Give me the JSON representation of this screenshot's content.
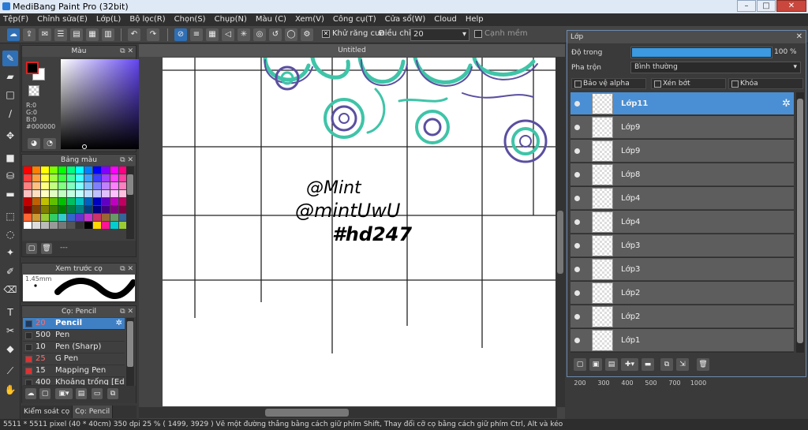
{
  "window": {
    "title": "MediBang Paint Pro (32bit)"
  },
  "menu": [
    "Tệp(F)",
    "Chỉnh sửa(E)",
    "Lớp(L)",
    "Bộ lọc(R)",
    "Chọn(S)",
    "Chụp(N)",
    "Màu (C)",
    "Xem(V)",
    "Công cụ(T)",
    "Cửa sổ(W)",
    "Cloud",
    "Help"
  ],
  "toolbar": {
    "antialias_label": "Khử răng cưa",
    "antialias_checked": "✕",
    "adjust_label": "Điều chỉnh",
    "adjust_value": "20",
    "smooth_label": "Cạnh mềm"
  },
  "color_panel": {
    "title": "Màu",
    "r": "R:0",
    "g": "G:0",
    "b": "B:0",
    "hex": "#000000",
    "fg_color": "#000000",
    "bg_color": "#ffffff"
  },
  "palette_panel": {
    "title": "Bảng màu",
    "name_placeholder": "---",
    "colors": [
      "#ff0000",
      "#ff8000",
      "#ffff00",
      "#80ff00",
      "#00ff00",
      "#00ff80",
      "#00ffff",
      "#0080ff",
      "#0000ff",
      "#8000ff",
      "#ff00ff",
      "#ff0080",
      "#ff4040",
      "#ffa040",
      "#ffff40",
      "#a0ff40",
      "#40ff40",
      "#40ffa0",
      "#40ffff",
      "#40a0ff",
      "#4040ff",
      "#a040ff",
      "#ff40ff",
      "#ff40a0",
      "#ff8080",
      "#ffc080",
      "#ffff80",
      "#c0ff80",
      "#80ff80",
      "#80ffc0",
      "#80ffff",
      "#80c0ff",
      "#8080ff",
      "#c080ff",
      "#ff80ff",
      "#ff80c0",
      "#ffc0c0",
      "#ffe0c0",
      "#ffffc0",
      "#e0ffc0",
      "#c0ffc0",
      "#c0ffe0",
      "#c0ffff",
      "#c0e0ff",
      "#c0c0ff",
      "#e0c0ff",
      "#ffc0ff",
      "#ffc0e0",
      "#c00000",
      "#c06000",
      "#c0c000",
      "#60c000",
      "#00c000",
      "#00c060",
      "#00c0c0",
      "#0060c0",
      "#0000c0",
      "#6000c0",
      "#c000c0",
      "#c00060",
      "#800000",
      "#804000",
      "#808000",
      "#408000",
      "#008000",
      "#008040",
      "#008080",
      "#004080",
      "#000080",
      "#400080",
      "#800080",
      "#800040",
      "#ff6633",
      "#cc9933",
      "#99cc33",
      "#33cc66",
      "#33cccc",
      "#3366cc",
      "#6633cc",
      "#cc33cc",
      "#cc3366",
      "#996633",
      "#669966",
      "#336699",
      "#ffffff",
      "#dddddd",
      "#bbbbbb",
      "#999999",
      "#777777",
      "#555555",
      "#333333",
      "#000000",
      "#ffd700",
      "#ff1493",
      "#00ced1",
      "#9acd32"
    ]
  },
  "preview_panel": {
    "title": "Xem trước cọ",
    "size": "1.45mm"
  },
  "brush_panel": {
    "title": "Cọ: Pencil",
    "brushes": [
      {
        "size": "20",
        "name": "Pencil",
        "color": "#1b3a66"
      },
      {
        "size": "500",
        "name": "Pen",
        "color": "#2c2c2c"
      },
      {
        "size": "10",
        "name": "Pen (Sharp)",
        "color": "#2c2c2c"
      },
      {
        "size": "25",
        "name": "G Pen",
        "color": "#e03030"
      },
      {
        "size": "15",
        "name": "Mapping Pen",
        "color": "#e03030"
      },
      {
        "size": "400",
        "name": "Khoảng trống [Edge I",
        "color": "#2c2c2c"
      }
    ]
  },
  "bottom_tabs": [
    "Kiểm soát cọ",
    "Cọ: Pencil"
  ],
  "canvas": {
    "tab_title": "Untitled",
    "sketch_lines": [
      "@Mint",
      "@mintUwU",
      "#hd247"
    ],
    "outline_purple": "#5a4fa0",
    "outline_teal": "#3fc4a8"
  },
  "layer_panel": {
    "title": "Lớp",
    "opacity_label": "Độ trong",
    "opacity_value": "100 %",
    "opacity_fraction": 1.0,
    "blend_label": "Pha trộn",
    "blend_value": "Bình thường",
    "protect_alpha": "Bảo vệ alpha",
    "clipping": "Xén bớt",
    "lock": "Khóa",
    "layers": [
      "Lớp11",
      "Lớp9",
      "Lớp9",
      "Lớp8",
      "Lớp4",
      "Lớp4",
      "Lớp3",
      "Lớp3",
      "Lớp2",
      "Lớp2",
      "Lớp1"
    ],
    "selected_index": 0
  },
  "sizes_row": [
    "200",
    "300",
    "400",
    "500",
    "700",
    "1000"
  ],
  "status": {
    "text": "5511 * 5511 pixel  (40 * 40cm)  350 dpi  25 %  ( 1499, 3929 )  Vẽ một đường thẳng bằng cách giữ phím Shift, Thay đổi cỡ cọ bằng cách giữ phím Ctrl, Alt và kéo"
  }
}
